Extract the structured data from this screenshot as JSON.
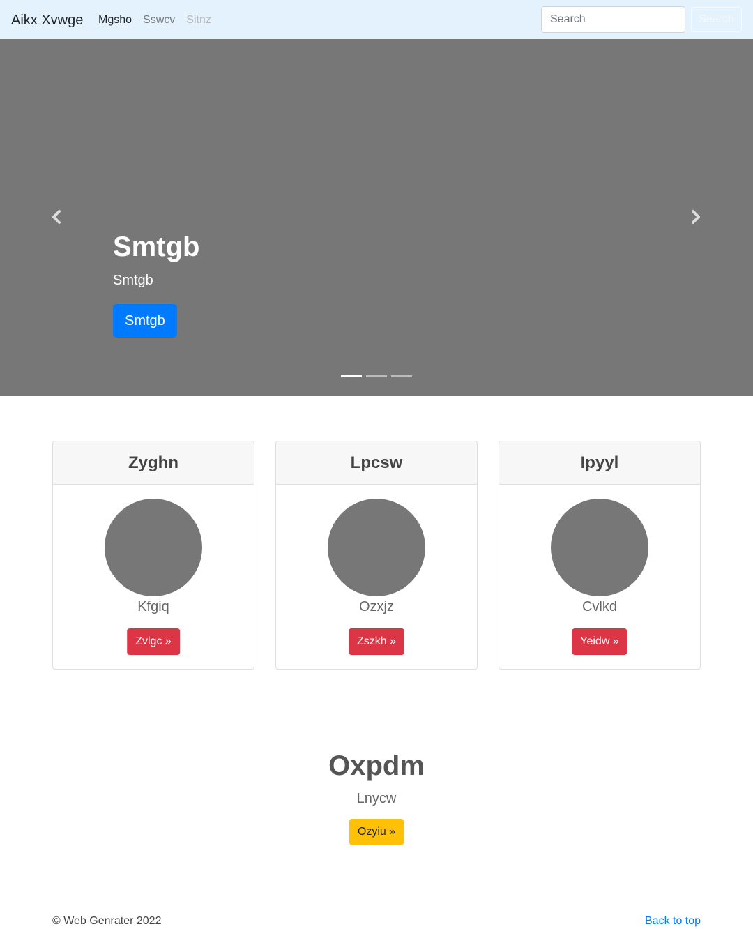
{
  "navbar": {
    "brand": "Aikx Xvwge",
    "links": [
      {
        "label": "Mgsho",
        "state": "active"
      },
      {
        "label": "Sswcv",
        "state": "normal"
      },
      {
        "label": "Sitnz",
        "state": "disabled"
      }
    ],
    "search_placeholder": "Search",
    "search_button": "Search",
    "background": "#e3f2fd"
  },
  "carousel": {
    "title": "Smtgb",
    "subtitle": "Smtgb",
    "button": "Smtgb",
    "slide_count": 3,
    "active_slide": 1,
    "prev_icon": "chevron-left-icon",
    "next_icon": "chevron-right-icon",
    "background": "#777777",
    "button_color": "#007bff"
  },
  "cards": [
    {
      "header": "Zyghn",
      "text": "Kfgiq",
      "button": "Zvlgc »"
    },
    {
      "header": "Lpcsw",
      "text": "Ozxjz",
      "button": "Zszkh »"
    },
    {
      "header": "Ipyyl",
      "text": "Cvlkd",
      "button": "Yeidw »"
    }
  ],
  "feature": {
    "title": "Oxpdm",
    "subtitle": "Lnycw",
    "button": "Ozyiu »",
    "button_color": "#ffc107"
  },
  "footer": {
    "copyright": "© Web Genrater 2022",
    "back_to_top": "Back to top"
  },
  "colors": {
    "card_button": "#dc3545",
    "link": "#007bff"
  }
}
